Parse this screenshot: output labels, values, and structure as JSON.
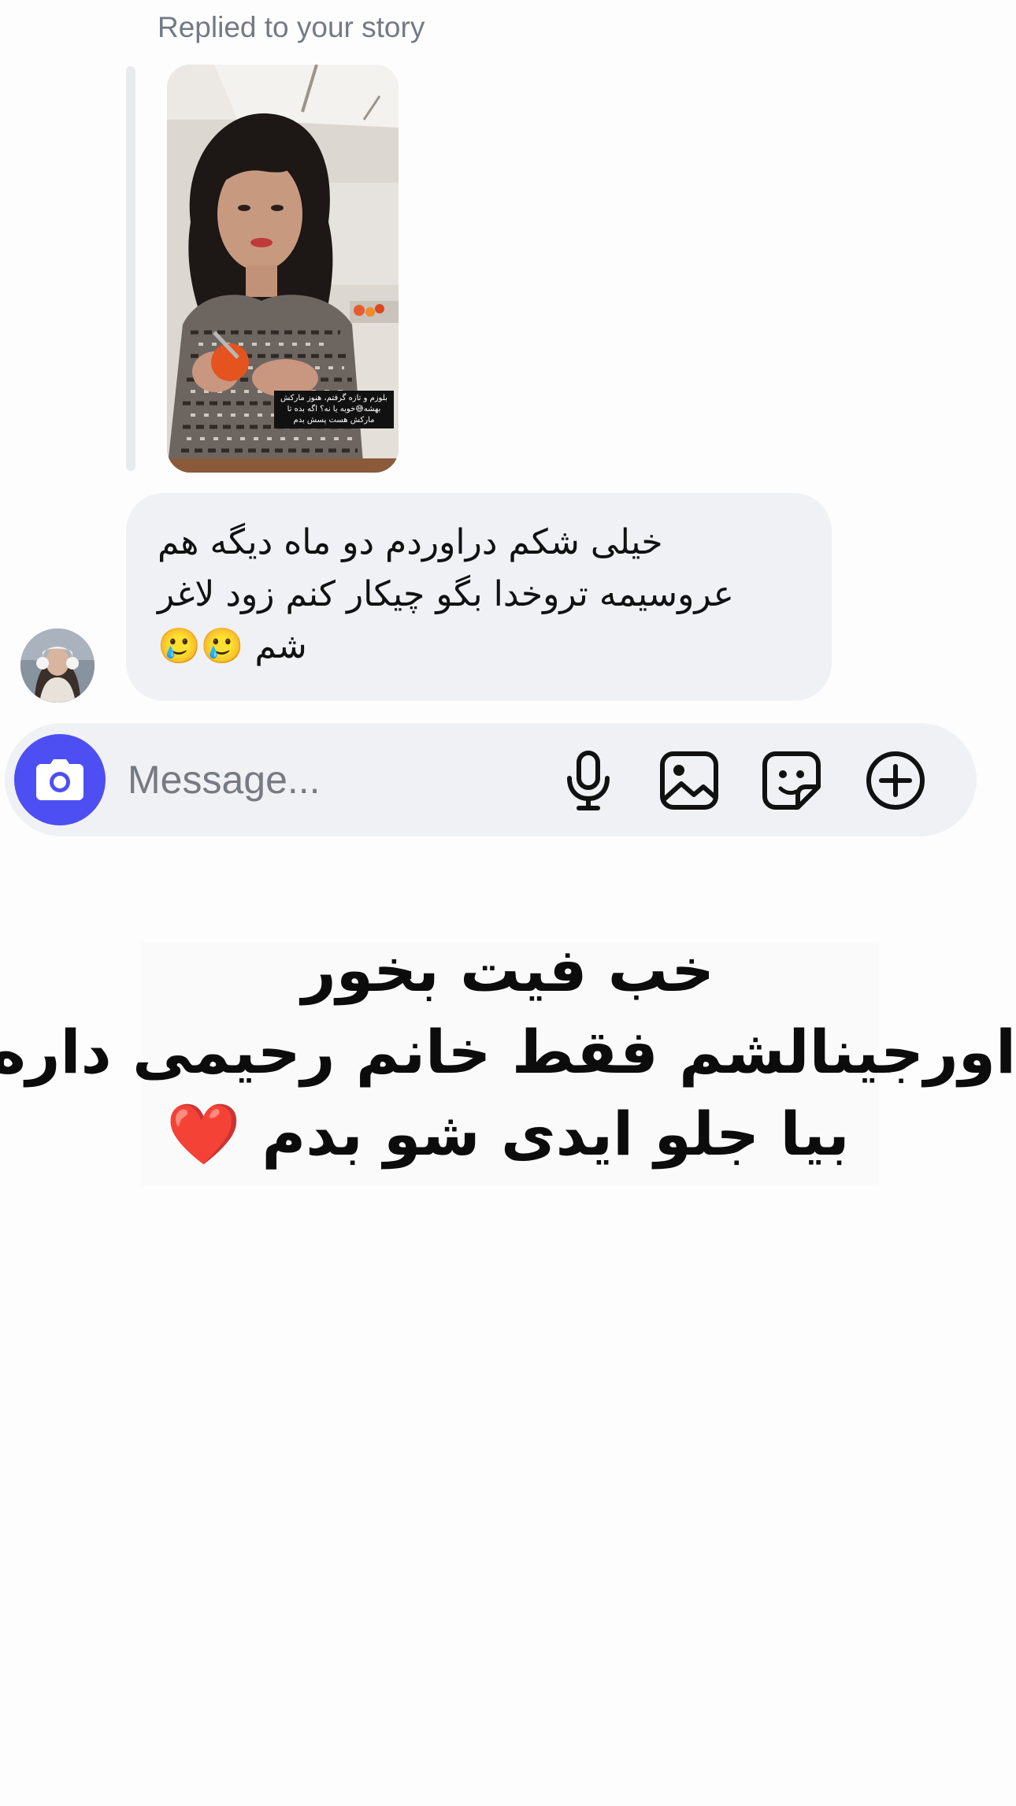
{
  "reply_header": {
    "label": "Replied to your story"
  },
  "story": {
    "caption": "بلوزم و تازه گرفتم، هنوز مارکش بهشه😅خوبه یا نه؟ اگه بده تا مارکش هست پسش بدم"
  },
  "message": {
    "text": "خیلی شکم دراوردم دو ماه دیگه هم عروسیمه تروخدا بگو چیکار کنم زود لاغر شم 🥲🥲"
  },
  "composer": {
    "placeholder": "Message...",
    "accent_color": "#4d4ff2"
  },
  "overlay_caption": {
    "lines": [
      "خب فیت بخور",
      "اورجینالشم فقط خانم رحیمی داره",
      "بیا جلو ایدی شو بدم"
    ],
    "heart": "❤️"
  },
  "icons": {
    "camera": "camera-icon",
    "mic": "microphone-icon",
    "gallery": "gallery-icon",
    "sticker": "sticker-icon",
    "plus": "plus-circle-icon"
  }
}
